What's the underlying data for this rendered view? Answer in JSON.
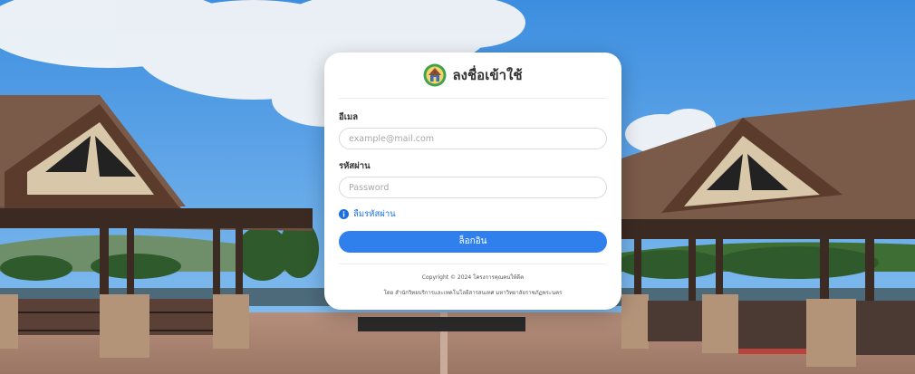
{
  "login": {
    "title": "ลงชื่อเข้าใช้",
    "email_label": "อีเมล",
    "email_placeholder": "example@mail.com",
    "password_label": "รหัสผ่าน",
    "password_placeholder": "Password",
    "forgot_password": "ลืมรหัสผ่าน",
    "submit_label": "ล็อกอิน",
    "copyright": "Copyright © 2024 โครงการคุณคนให้ดีค",
    "footer_note": "โดย สำนักวิทยบริการและเทคโนโลยีสารสนเทศ มหาวิทยาลัยราชภัฏพระนคร"
  },
  "colors": {
    "primary_button": "#2f80ed",
    "link": "#1b6fe0",
    "sky": "#5aa3e6"
  },
  "icons": {
    "logo": "university-logo-icon",
    "info": "info-circle-icon"
  }
}
